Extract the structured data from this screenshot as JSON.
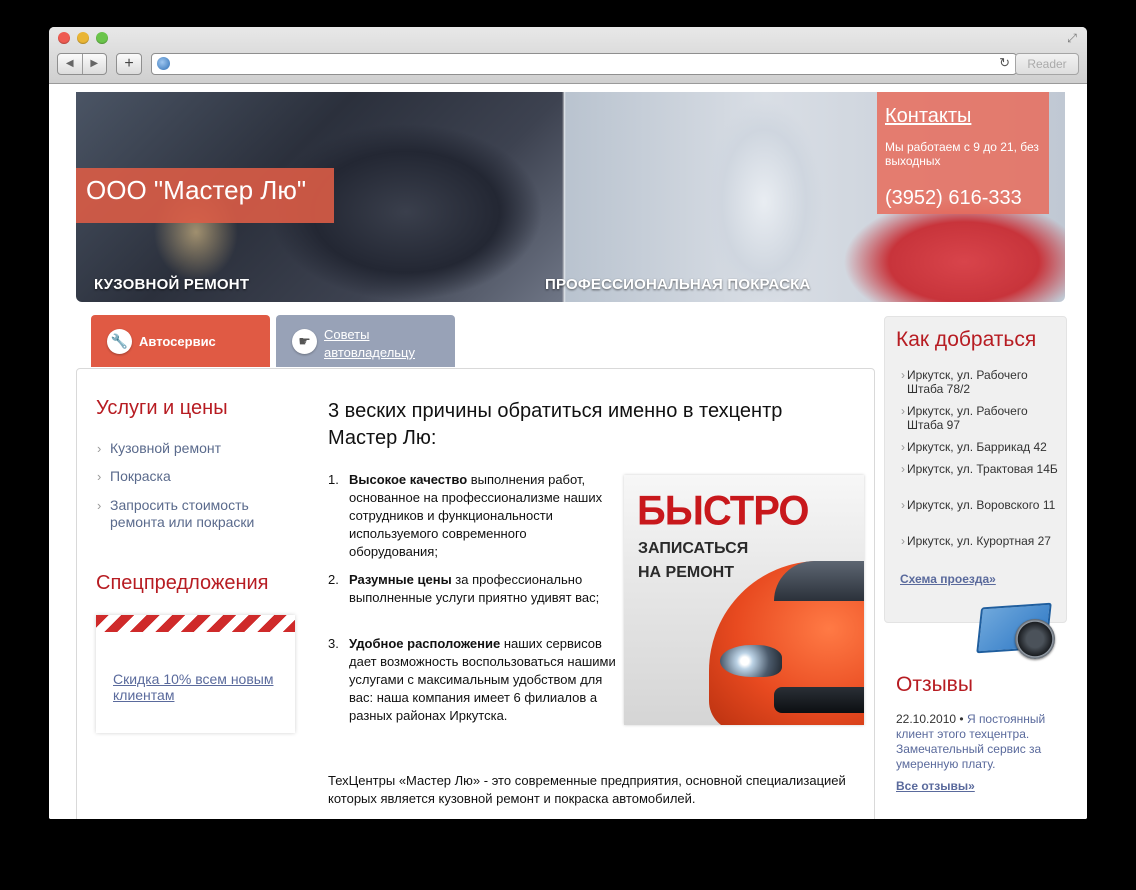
{
  "browser": {
    "url": "",
    "reader_label": "Reader",
    "back_glyph": "◀",
    "forward_glyph": "▶",
    "add_glyph": "+",
    "reload_glyph": "↻",
    "resize_glyph": "⤢"
  },
  "banner": {
    "company_name": "ООО \"Мастер Лю\"",
    "caption_left": "КУЗОВНОЙ РЕМОНТ",
    "caption_right": "ПРОФЕССИОНАЛЬНАЯ ПОКРАСКА",
    "contacts_title": "Контакты",
    "contacts_hours": "Мы работаем с 9 до 21, без выходных",
    "contacts_phone": "(3952) 616-333"
  },
  "tabs": [
    {
      "label": "Автосервис",
      "icon": "wrench-icon",
      "glyph": "🔧",
      "active": true
    },
    {
      "label": "Советы автовладельцу",
      "icon": "hand-icon",
      "glyph": "☛",
      "active": false
    }
  ],
  "left": {
    "services_title": "Услуги и цены",
    "services": [
      "Кузовной ремонт",
      "Покраска",
      "Запросить стоимость ремонта или покраски"
    ],
    "specials_title": "Спецпредложения",
    "special_link": "Скидка 10% всем новым клиентам"
  },
  "main": {
    "heading": "3 веских причины обратиться именно в техцентр Мастер Лю:",
    "reasons": [
      {
        "num": "1.",
        "bold": "Высокое качество",
        "text": " выполнения работ, основанное на профессионализме наших сотрудников и функциональности используемого современного оборудования;"
      },
      {
        "num": "2.",
        "bold": "Разумные цены",
        "text": " за профессионально выполненные услуги приятно удивят вас;"
      },
      {
        "num": "3.",
        "bold": "Удобное расположение",
        "text": " наших сервисов дает возможность воспользоваться нашими услугами с максимальным удобством для вас: наша компания имеет 6 филиалов а разных районах Иркутска."
      }
    ],
    "promo_title": "БЫСТРО",
    "promo_sub": "ЗАПИСАТЬСЯ НА РЕМОНТ",
    "footer_text": "ТехЦентры «Мастер Лю» - это современные предприятия, основной специализацией которых является кузовной ремонт и покраска автомобилей."
  },
  "sidebar": {
    "how_title": "Как добраться",
    "addresses": [
      "Иркутск, ул. Рабочего Штаба 78/2",
      "Иркутск, ул. Рабочего Штаба 97",
      "Иркутск, ул. Баррикад 42",
      "Иркутск, ул. Трактовая 14Б",
      "Иркутск, ул. Воровского 11",
      "Иркутск, ул. Курортная 27"
    ],
    "scheme_link": "Схема проезда»",
    "reviews_title": "Отзывы",
    "review_date": "22.10.2010",
    "review_sep": " • ",
    "review_text": "Я постоянный клиент этого техцентра. Замечательный сервис за умеренную плату.",
    "all_reviews": "Все отзывы»"
  }
}
